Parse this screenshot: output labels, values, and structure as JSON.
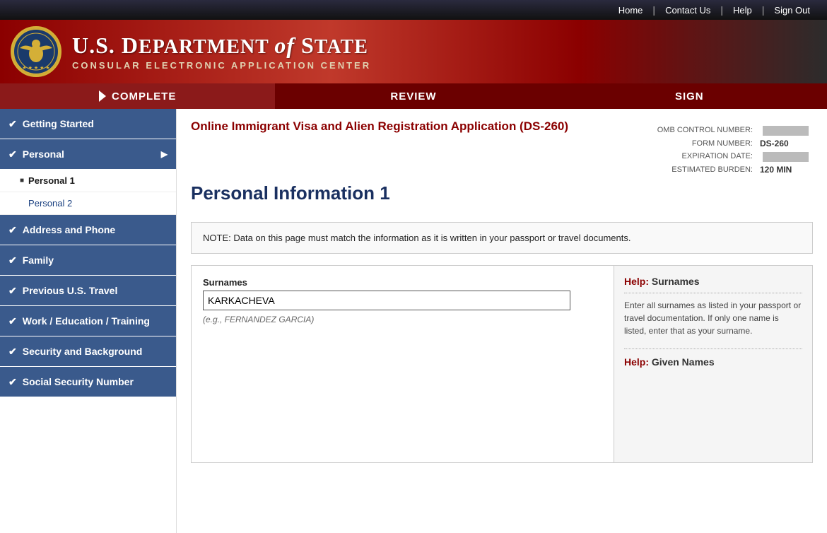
{
  "topnav": {
    "home": "Home",
    "contact": "Contact Us",
    "help": "Help",
    "signout": "Sign Out"
  },
  "header": {
    "title_1": "U.S. D",
    "title_2": "EPARTMENT ",
    "title_italic": "of",
    "title_3": " S",
    "title_4": "TATE",
    "full_title": "U.S. Department of State",
    "subtitle": "CONSULAR ELECTRONIC APPLICATION CENTER"
  },
  "tabs": [
    {
      "id": "complete",
      "label": "COMPLETE",
      "active": true
    },
    {
      "id": "review",
      "label": "REVIEW",
      "active": false
    },
    {
      "id": "sign",
      "label": "SIGN",
      "active": false
    }
  ],
  "sidebar": {
    "items": [
      {
        "id": "getting-started",
        "label": "Getting Started",
        "check": "✔",
        "has_sub": false
      },
      {
        "id": "personal",
        "label": "Personal",
        "check": "✔",
        "has_sub": true,
        "sub": [
          {
            "id": "personal-1",
            "label": "Personal 1",
            "active": true
          },
          {
            "id": "personal-2",
            "label": "Personal 2",
            "active": false
          }
        ]
      },
      {
        "id": "address-phone",
        "label": "Address and Phone",
        "check": "✔",
        "has_sub": false
      },
      {
        "id": "family",
        "label": "Family",
        "check": "✔",
        "has_sub": false
      },
      {
        "id": "previous-travel",
        "label": "Previous U.S. Travel",
        "check": "✔",
        "has_sub": false
      },
      {
        "id": "work-education",
        "label": "Work / Education / Training",
        "check": "✔",
        "has_sub": false
      },
      {
        "id": "security",
        "label": "Security and Background",
        "check": "✔",
        "has_sub": false
      },
      {
        "id": "ssn",
        "label": "Social Security Number",
        "check": "✔",
        "has_sub": false
      }
    ]
  },
  "content": {
    "form_link": "Online Immigrant Visa and Alien Registration Application (DS-260)",
    "meta": {
      "omb_label": "OMB CONTROL NUMBER:",
      "omb_value": "",
      "form_label": "FORM NUMBER:",
      "form_value": "DS-260",
      "exp_label": "EXPIRATION DATE:",
      "exp_value": "",
      "burden_label": "ESTIMATED BURDEN:",
      "burden_value": "120 MIN"
    },
    "page_title": "Personal Information 1",
    "note": "NOTE: Data on this page must match the information as it is written in your passport or travel documents.",
    "fields": {
      "surnames_label": "Surnames",
      "surnames_value": "KARKACHEVA",
      "surnames_placeholder": "(e.g., FERNANDEZ GARCIA)"
    },
    "help": {
      "surnames_title": "Help:",
      "surnames_keyword": "Surnames",
      "surnames_text": "Enter all surnames as listed in your passport or travel documentation. If only one name is listed, enter that as your surname.",
      "given_title": "Help:",
      "given_keyword": "Given Names"
    }
  }
}
